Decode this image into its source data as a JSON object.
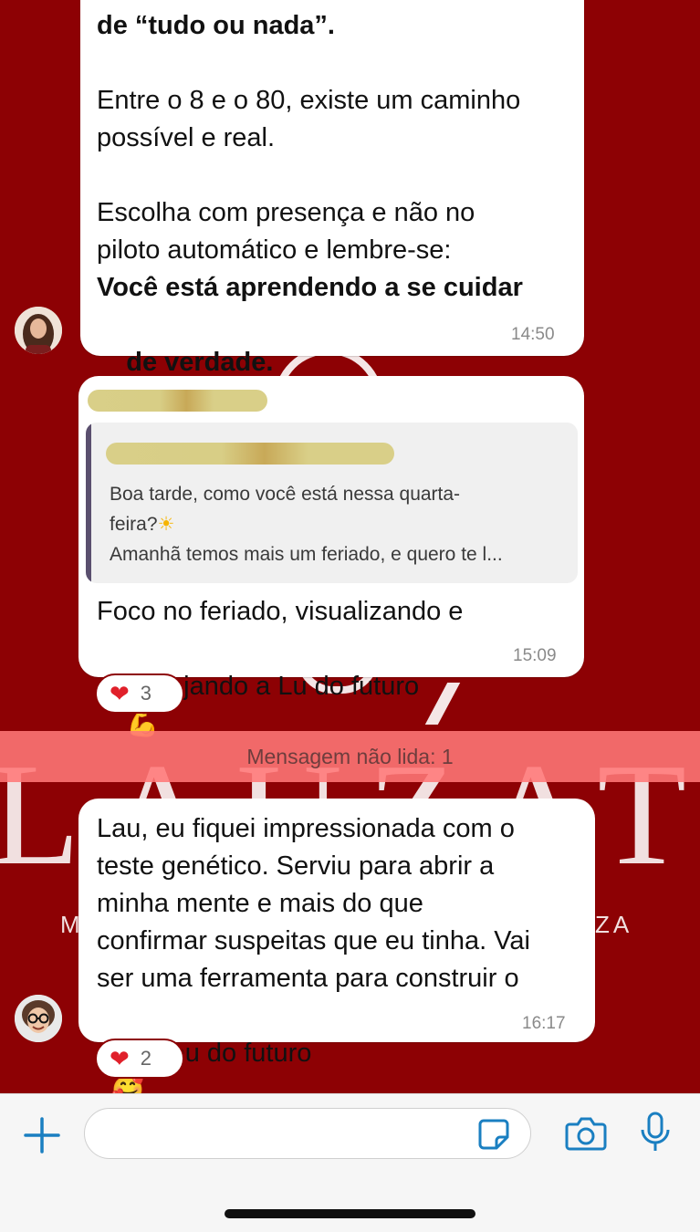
{
  "colors": {
    "wallpaper": "#8d0104",
    "bubble": "#ffffff",
    "accent_blue": "#1a7fc1",
    "heart": "#e0202a",
    "unread_banner": "#ff7878"
  },
  "messages": [
    {
      "id": "msg1",
      "lines": {
        "l1": "de “tudo ou nada”.",
        "l2": "Entre o 8 e o 80, existe um caminho",
        "l3": "possível e real.",
        "l4": "Escolha com presença e não no",
        "l5": "piloto automático e lembre-se:",
        "l6": "Você está aprendendo a se cuidar",
        "l7": "de verdade."
      },
      "emoji": "💛",
      "time": "14:50"
    },
    {
      "id": "msg2",
      "quote": {
        "line1": "Boa tarde, como você está nessa quarta-",
        "line2": "feira?",
        "line2_emoji": "☀",
        "line3": "Amanhã temos mais um feriado, e quero te l..."
      },
      "lines": {
        "l1": "Foco no feriado, visualizando e",
        "l2": "desejando a Lu do futuro"
      },
      "emoji": "💪",
      "time": "15:09",
      "reaction": {
        "icon": "heart-icon",
        "count": "3"
      }
    },
    {
      "id": "msg3",
      "lines": {
        "l1": "Lau, eu fiquei impressionada com o",
        "l2": "teste genético. Serviu para abrir a",
        "l3": "minha mente e mais do que",
        "l4": "confirmar suspeitas que eu tinha. Vai",
        "l5": "ser uma ferramenta para construir o",
        "l6": "meu eu do futuro"
      },
      "emoji": "🥰",
      "time": "16:17",
      "reaction": {
        "icon": "heart-icon",
        "count": "2"
      }
    }
  ],
  "unread_banner": "Mensagem não lida: 1",
  "input_bar": {
    "placeholder": "",
    "icons": [
      "plus-icon",
      "sticker-icon",
      "camera-icon",
      "microphone-icon"
    ]
  }
}
